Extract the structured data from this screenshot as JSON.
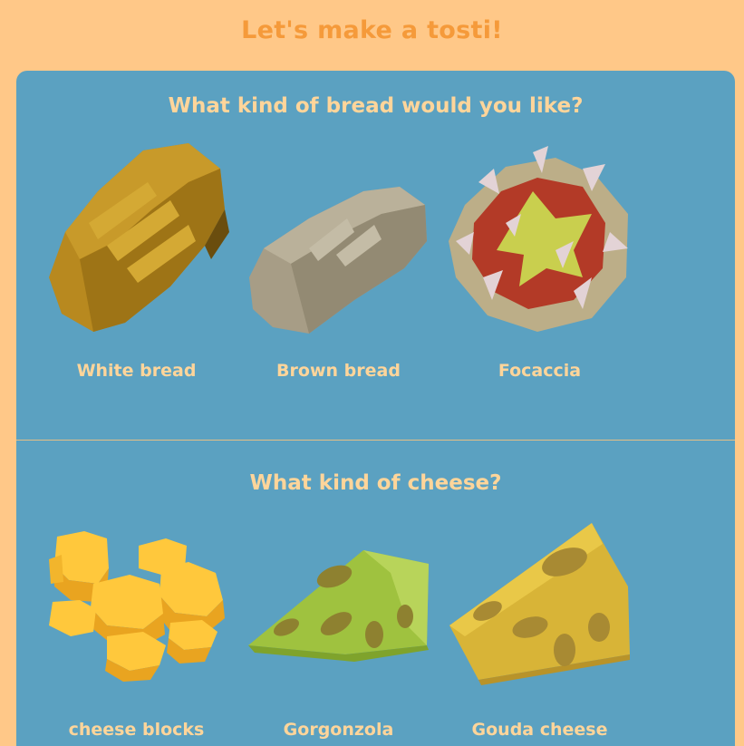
{
  "header": {
    "title": "Let's make a tosti!"
  },
  "bread_section": {
    "question": "What kind of bread would you like?",
    "options": [
      {
        "label": "White bread",
        "icon": "white-bread-loaf-icon"
      },
      {
        "label": "Brown bread",
        "icon": "brown-bread-loaf-icon"
      },
      {
        "label": "Focaccia",
        "icon": "focaccia-icon"
      }
    ]
  },
  "cheese_section": {
    "question": "What kind of cheese?",
    "options": [
      {
        "label": "cheese blocks",
        "icon": "cheese-blocks-icon"
      },
      {
        "label": "Gorgonzola",
        "icon": "gorgonzola-icon"
      },
      {
        "label": "Gouda cheese",
        "icon": "gouda-cheese-icon"
      }
    ]
  },
  "colors": {
    "page_background": "#ffc888",
    "panel_background": "#5ba1c1",
    "title_text": "#f59a3a",
    "panel_text": "#ffd59a"
  }
}
